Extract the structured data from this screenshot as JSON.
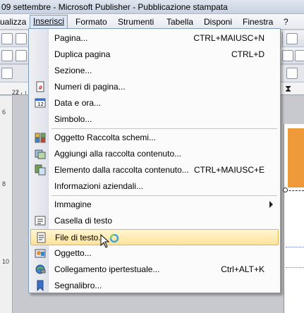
{
  "window": {
    "title": "09 settembre - Microsoft Publisher - Pubblicazione stampata"
  },
  "menubar": {
    "items": [
      {
        "label": "ualizza"
      },
      {
        "label": "Inserisci"
      },
      {
        "label": "Formato"
      },
      {
        "label": "Strumenti"
      },
      {
        "label": "Tabella"
      },
      {
        "label": "Disponi"
      },
      {
        "label": "Finestra"
      },
      {
        "label": "?"
      }
    ]
  },
  "ruler": {
    "number": "22"
  },
  "vruler": {
    "numbers": [
      "6",
      "8",
      "10"
    ]
  },
  "insert_menu": {
    "items": [
      {
        "label": "Pagina...",
        "shortcut": "CTRL+MAIUSC+N",
        "icon": "page-icon"
      },
      {
        "label": "Duplica pagina",
        "shortcut": "CTRL+D",
        "icon": ""
      },
      {
        "label": "Sezione...",
        "shortcut": "",
        "icon": ""
      },
      {
        "label": "Numeri di pagina...",
        "shortcut": "",
        "icon": "page-number-icon"
      },
      {
        "label": "Data e ora...",
        "shortcut": "",
        "icon": "date-time-icon"
      },
      {
        "label": "Simbolo...",
        "shortcut": "",
        "icon": ""
      },
      {
        "label": "Oggetto Raccolta schemi...",
        "shortcut": "",
        "icon": "design-gallery-icon"
      },
      {
        "label": "Aggiungi alla raccolta contenuto...",
        "shortcut": "",
        "icon": "add-content-library-icon"
      },
      {
        "label": "Elemento dalla raccolta contenuto...",
        "shortcut": "CTRL+MAIUSC+E",
        "icon": "content-library-item-icon"
      },
      {
        "label": "Informazioni aziendali...",
        "shortcut": "",
        "icon": ""
      },
      {
        "label": "Immagine",
        "shortcut": "",
        "icon": ""
      },
      {
        "label": "Casella di testo",
        "shortcut": "",
        "icon": "text-box-icon"
      },
      {
        "label": "File di testo...",
        "shortcut": "",
        "icon": "text-file-icon"
      },
      {
        "label": "Oggetto...",
        "shortcut": "",
        "icon": "object-icon"
      },
      {
        "label": "Collegamento ipertestuale...",
        "shortcut": "Ctrl+ALT+K",
        "icon": "hyperlink-icon"
      },
      {
        "label": "Segnalibro...",
        "shortcut": "",
        "icon": "bookmark-icon"
      }
    ]
  },
  "colors": {
    "highlight": "#ffe39a",
    "accent_orange": "#ee9a3a",
    "menu_border": "#7f9db9"
  }
}
